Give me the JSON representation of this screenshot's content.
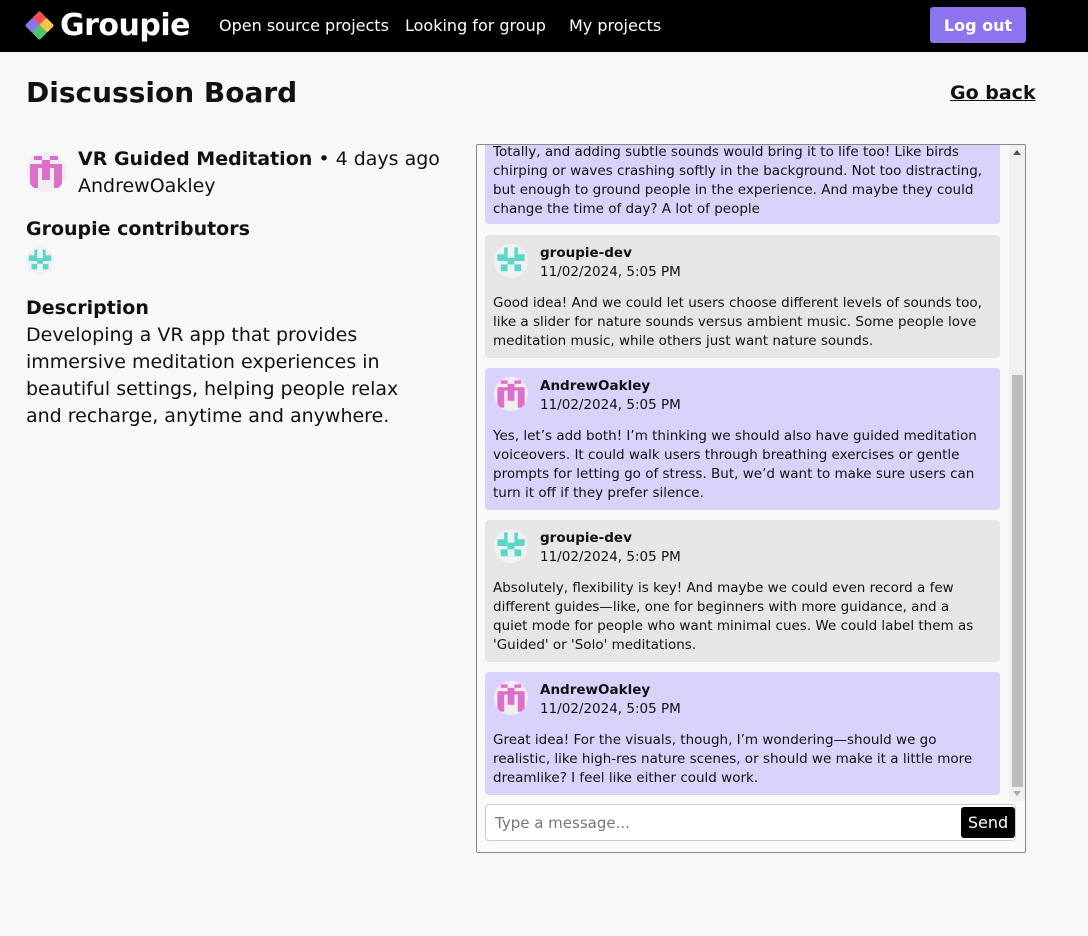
{
  "app": {
    "name": "Groupie",
    "nav": [
      "Open source projects",
      "Looking for group",
      "My projects"
    ],
    "logout_label": "Log out",
    "colors": {
      "accent": "#8b74ed",
      "user_bubble": "#d9d2fb",
      "other_bubble": "#e6e6e6",
      "owner_avatar": "#de6fc9",
      "dev_avatar": "#5ad6c9"
    }
  },
  "page": {
    "title": "Discussion Board",
    "go_back": "Go back"
  },
  "project": {
    "name": "VR Guided Meditation",
    "age": " • 4 days ago",
    "owner": "AndrewOakley",
    "contributors_heading": "Groupie contributors",
    "description_heading": "Description",
    "description": "Developing a VR app that provides immersive meditation experiences in beautiful settings, helping people relax and recharge, anytime and anywhere."
  },
  "chat": {
    "messages": [
      {
        "author": "",
        "time": "",
        "own": true,
        "text": "Totally, and adding subtle sounds would bring it to life too! Like birds chirping or waves crashing softly in the background. Not too distracting, but enough to ground people in the experience. And maybe they could change the time of day? A lot of people"
      },
      {
        "author": "groupie-dev",
        "time": "11/02/2024, 5:05 PM",
        "own": false,
        "text": "Good idea! And we could let users choose different levels of sounds too, like a slider for nature sounds versus ambient music. Some people love meditation music, while others just want nature sounds."
      },
      {
        "author": "AndrewOakley",
        "time": "11/02/2024, 5:05 PM",
        "own": true,
        "text": "Yes, let’s add both! I’m thinking we should also have guided meditation voiceovers. It could walk users through breathing exercises or gentle prompts for letting go of stress. But, we’d want to make sure users can turn it off if they prefer silence."
      },
      {
        "author": "groupie-dev",
        "time": "11/02/2024, 5:05 PM",
        "own": false,
        "text": "Absolutely, flexibility is key! And maybe we could even record a few different guides—like, one for beginners with more guidance, and a quiet mode for people who want minimal cues. We could label them as 'Guided' or 'Solo' meditations."
      },
      {
        "author": "AndrewOakley",
        "time": "11/02/2024, 5:05 PM",
        "own": true,
        "text": "Great idea! For the visuals, though, I’m wondering—should we go realistic, like high-res nature scenes, or should we make it a little more dreamlike? I feel like either could work."
      }
    ],
    "input_placeholder": "Type a message...",
    "input_value": "",
    "send_label": "Send"
  }
}
